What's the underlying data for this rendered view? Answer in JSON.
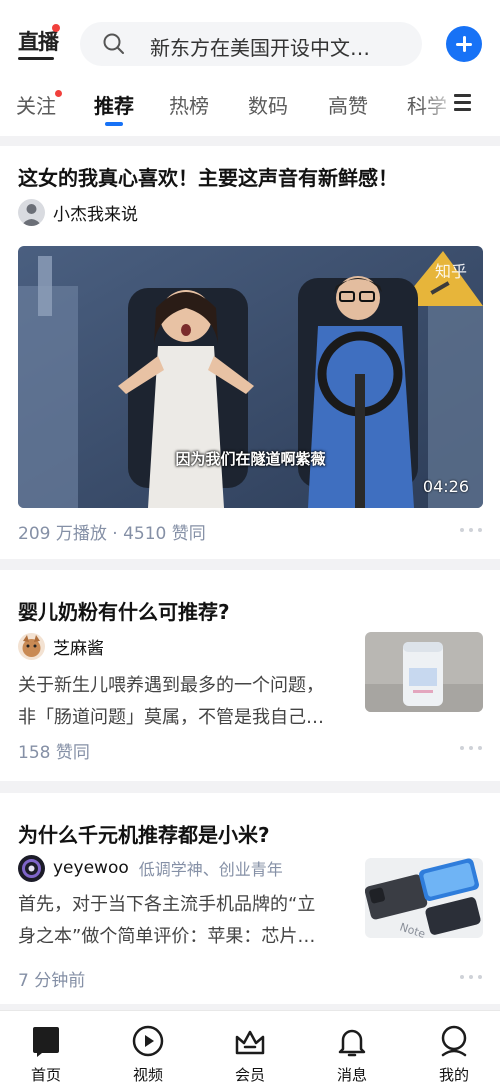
{
  "header": {
    "live_label": "直播",
    "search_placeholder": "新东方在美国开设中文…"
  },
  "tabs": [
    {
      "label": "关注",
      "has_dot": true
    },
    {
      "label": "推荐",
      "active": true
    },
    {
      "label": "热榜"
    },
    {
      "label": "数码"
    },
    {
      "label": "高赞"
    },
    {
      "label": "科学"
    }
  ],
  "feed": {
    "video_card": {
      "title": "这女的我真心喜欢！主要这声音有新鲜感！",
      "author": "小杰我来说",
      "watermark": "知乎",
      "subtitle": "因为我们在隧道啊紫薇",
      "duration": "04:26",
      "meta": "209 万播放 · 4510 赞同"
    },
    "card_baby": {
      "title": "婴儿奶粉有什么可推荐?",
      "author": "芝麻酱",
      "excerpt_lines": [
        "关于新生儿喂养遇到最多的一个问题，",
        "非「肠道问题」莫属，不管是我自己…"
      ],
      "meta": "158 赞同"
    },
    "card_phone": {
      "title": "为什么千元机推荐都是小米?",
      "author": "yeyewoo",
      "author_desc": "低调学神、创业青年",
      "excerpt_lines": [
        "首先，对于当下各主流手机品牌的“立",
        "身之本”做个简单评价：苹果：芯片…"
      ],
      "meta": "7 分钟前",
      "thumb_text": "Note"
    }
  },
  "bottom_nav": [
    {
      "label": "首页",
      "icon": "home-icon",
      "active": true
    },
    {
      "label": "视频",
      "icon": "video-play-icon"
    },
    {
      "label": "会员",
      "icon": "crown-icon"
    },
    {
      "label": "消息",
      "icon": "bell-icon"
    },
    {
      "label": "我的",
      "icon": "profile-icon"
    }
  ],
  "colors": {
    "accent": "#1772f6",
    "dot": "#f1403c",
    "meta": "#8590a6"
  }
}
